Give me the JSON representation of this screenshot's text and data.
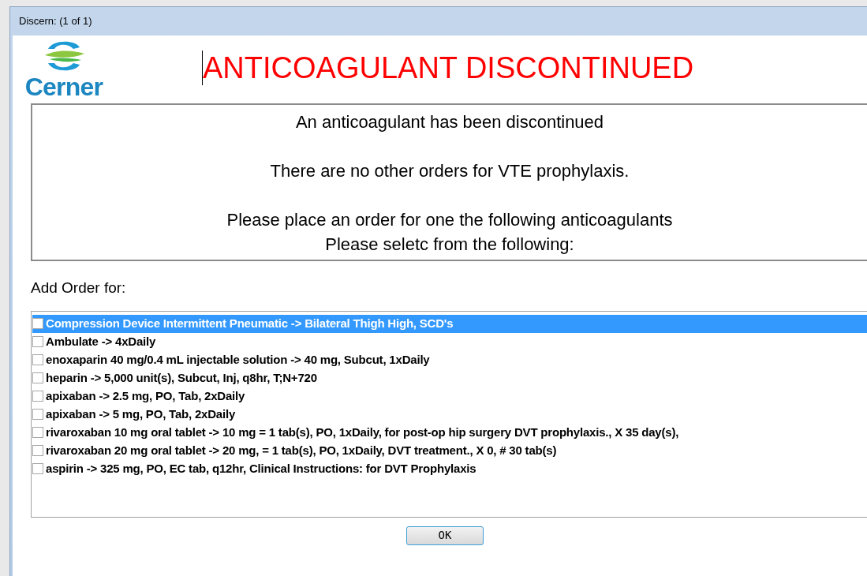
{
  "window": {
    "title": "Discern:  (1 of 1)"
  },
  "logo": {
    "text": "Cerner"
  },
  "heading": "ANTICOAGULANT DISCONTINUED",
  "message": [
    "An anticoagulant has been discontinued",
    "There are no other orders for VTE prophylaxis.",
    "Please place an order for one the following anticoagulants\nPlease seletc from the following:"
  ],
  "orders_label": "Add Order for:",
  "orders": [
    {
      "label": "Compression Device Intermittent Pneumatic -> Bilateral Thigh High, SCD's",
      "checked": false,
      "selected": true
    },
    {
      "label": "Ambulate -> 4xDaily",
      "checked": false,
      "selected": false
    },
    {
      "label": "enoxaparin 40 mg/0.4 mL injectable solution -> 40 mg, Subcut, 1xDaily",
      "checked": false,
      "selected": false
    },
    {
      "label": "heparin -> 5,000 unit(s), Subcut, Inj, q8hr, T;N+720",
      "checked": false,
      "selected": false
    },
    {
      "label": "apixaban -> 2.5 mg, PO, Tab, 2xDaily",
      "checked": false,
      "selected": false
    },
    {
      "label": "apixaban -> 5 mg, PO, Tab, 2xDaily",
      "checked": false,
      "selected": false
    },
    {
      "label": "rivaroxaban 10 mg oral tablet -> 10 mg = 1 tab(s), PO, 1xDaily, for post-op hip surgery DVT prophylaxis., X 35 day(s),",
      "checked": false,
      "selected": false
    },
    {
      "label": "rivaroxaban 20 mg oral tablet -> 20 mg, = 1 tab(s), PO, 1xDaily, DVT treatment., X 0, # 30 tab(s)",
      "checked": false,
      "selected": false
    },
    {
      "label": "aspirin -> 325 mg, PO, EC tab, q12hr, Clinical Instructions: for DVT Prophylaxis",
      "checked": false,
      "selected": false
    }
  ],
  "buttons": [
    "OK"
  ]
}
